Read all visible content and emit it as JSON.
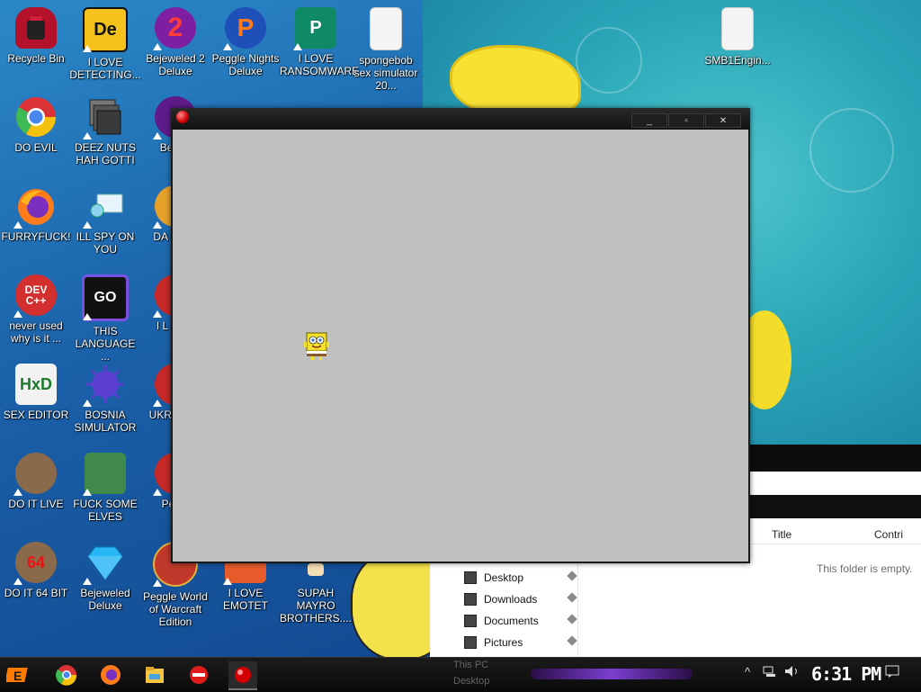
{
  "desktop": {
    "icons": [
      {
        "label": "Recycle Bin",
        "glyph": "",
        "color": "#b3122a"
      },
      {
        "label": "I LOVE DETECTING...",
        "glyph": "De",
        "color": "#1a1a1a"
      },
      {
        "label": "Bejeweled 2 Deluxe",
        "glyph": "2",
        "color": "#c22c7a"
      },
      {
        "label": "Peggle Nights Deluxe",
        "glyph": "P",
        "color": "#e63a2a"
      },
      {
        "label": "I LOVE RANSOMWARE",
        "glyph": "P",
        "color": "#1aa37a"
      },
      {
        "label": "spongebob sex simulator 20...",
        "glyph": "",
        "color": "#f2f2f2"
      },
      {
        "label": "SMB1Engin...",
        "glyph": "",
        "color": "#f2f2f2"
      },
      {
        "label": "DO EVIL",
        "glyph": "",
        "color": "#2e7d32"
      },
      {
        "label": "DEEZ NUTS HAH GOTTI",
        "glyph": "",
        "color": "#5a5a5a"
      },
      {
        "label": "FURRYFUCK!",
        "glyph": "",
        "color": "#e8702a"
      },
      {
        "label": "ILL SPY ON YOU",
        "glyph": "",
        "color": "#4aa3df"
      },
      {
        "label": "never used why is it ...",
        "glyph": "DEV C++",
        "color": "#c62828"
      },
      {
        "label": "THIS LANGUAGE ...",
        "glyph": "GO",
        "color": "#111"
      },
      {
        "label": "SEX EDITOR",
        "glyph": "HxD",
        "color": "#f0f0f0"
      },
      {
        "label": "BOSNIA SIMULATOR",
        "glyph": "",
        "color": "#5b3fd1"
      },
      {
        "label": "DO IT LIVE",
        "glyph": "",
        "color": "#7a4a2a"
      },
      {
        "label": "FUCK SOME ELVES",
        "glyph": "",
        "color": "#3a7a3a"
      },
      {
        "label": "DO IT 64 BIT",
        "glyph": "64",
        "color": "#7a4a2a"
      },
      {
        "label": "Bejeweled Deluxe",
        "glyph": "",
        "color": "#29b6f6"
      },
      {
        "label": "Peggle World of Warcraft Edition",
        "glyph": "",
        "color": "#c0392b"
      },
      {
        "label": "I LOVE EMOTET",
        "glyph": "",
        "color": "#e65c2a"
      },
      {
        "label": "SUPAH MAYRO BROTHERS....",
        "glyph": "",
        "color": "#d32f2f"
      },
      {
        "label": "Beje T",
        "glyph": "",
        "color": "#8e24aa"
      },
      {
        "label": "DA SIMU",
        "glyph": "",
        "color": "#e6a12a"
      },
      {
        "label": "I L CHU",
        "glyph": "",
        "color": "#c62828"
      },
      {
        "label": "UKR SIMU",
        "glyph": "",
        "color": "#c62828"
      },
      {
        "label": "Peggl",
        "glyph": "",
        "color": "#c62828"
      }
    ]
  },
  "window": {
    "title": "",
    "minimize": "_",
    "maximize": "▫",
    "close": "✕",
    "client_bg": "#c0c0c0"
  },
  "explorer": {
    "columns": {
      "title": "Title",
      "contrib": "Contri"
    },
    "nav": [
      {
        "label": "Desktop"
      },
      {
        "label": "Downloads"
      },
      {
        "label": "Documents"
      },
      {
        "label": "Pictures"
      }
    ],
    "empty_text": "This folder is empty."
  },
  "taskbar": {
    "ghost_this_pc": "This PC",
    "ghost_desktop": "Desktop",
    "time": "6:31 PM",
    "tray_up": "^"
  }
}
